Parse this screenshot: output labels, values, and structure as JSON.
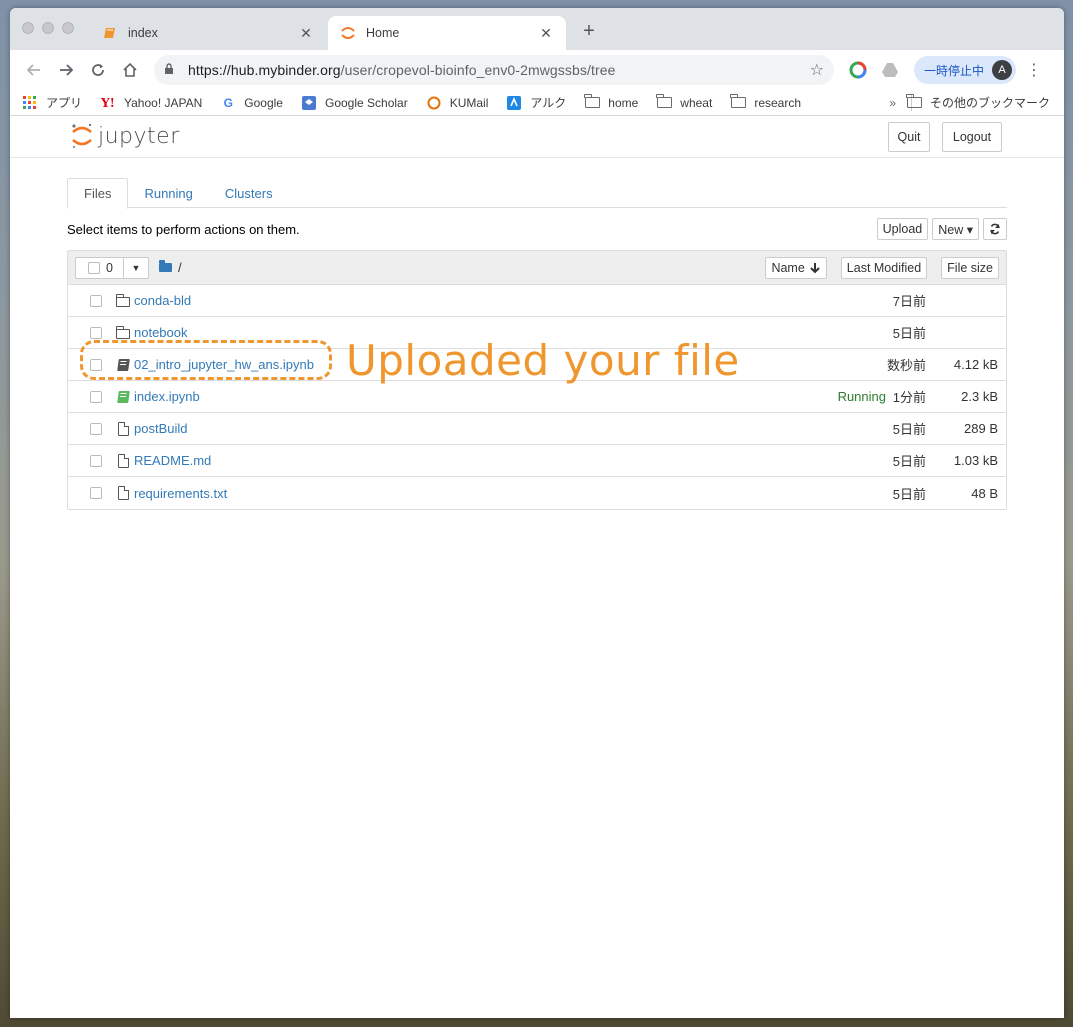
{
  "browser": {
    "tabs": [
      {
        "title": "index"
      },
      {
        "title": "Home"
      }
    ],
    "url_host": "https://hub.mybinder.org",
    "url_path": "/user/cropevol-bioinfo_env0-2mwgssbs/tree",
    "pause_label": "一時停止中",
    "avatar_letter": "A"
  },
  "bookmarks": {
    "items": [
      {
        "label": "アプリ",
        "icon": "apps-grid-icon"
      },
      {
        "label": "Yahoo! JAPAN",
        "icon": "yahoo-icon"
      },
      {
        "label": "Google",
        "icon": "google-icon"
      },
      {
        "label": "Google Scholar",
        "icon": "scholar-icon"
      },
      {
        "label": "KUMail",
        "icon": "kumail-icon"
      },
      {
        "label": "アルク",
        "icon": "alc-icon"
      },
      {
        "label": "home",
        "icon": "folder-icon"
      },
      {
        "label": "wheat",
        "icon": "folder-icon"
      },
      {
        "label": "research",
        "icon": "folder-icon"
      }
    ],
    "more": "»",
    "other": "その他のブックマーク"
  },
  "jupyter": {
    "logo_text": "jupyter",
    "quit": "Quit",
    "logout": "Logout",
    "tabs": [
      "Files",
      "Running",
      "Clusters"
    ],
    "hint": "Select items to perform actions on them.",
    "upload": "Upload",
    "new": "New ▾",
    "selected_count": "0",
    "breadcrumb": "/",
    "sort_name": "Name",
    "sort_modified": "Last Modified",
    "sort_size": "File size",
    "files": [
      {
        "name": "conda-bld",
        "type": "folder",
        "modified": "7日前",
        "size": "",
        "status": ""
      },
      {
        "name": "notebook",
        "type": "folder",
        "modified": "5日前",
        "size": "",
        "status": ""
      },
      {
        "name": "02_intro_jupyter_hw_ans.ipynb",
        "type": "notebook",
        "modified": "数秒前",
        "size": "4.12 kB",
        "status": ""
      },
      {
        "name": "index.ipynb",
        "type": "notebook-running",
        "modified": "1分前",
        "size": "2.3 kB",
        "status": "Running"
      },
      {
        "name": "postBuild",
        "type": "file",
        "modified": "5日前",
        "size": "289 B",
        "status": ""
      },
      {
        "name": "README.md",
        "type": "file",
        "modified": "5日前",
        "size": "1.03 kB",
        "status": ""
      },
      {
        "name": "requirements.txt",
        "type": "file",
        "modified": "5日前",
        "size": "48 B",
        "status": ""
      }
    ]
  },
  "annotation": {
    "text": "Uploaded your file",
    "color": "#f0962e"
  }
}
